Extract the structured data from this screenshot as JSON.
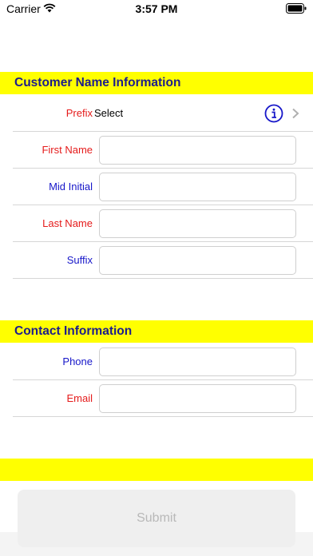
{
  "status_bar": {
    "carrier": "Carrier",
    "time": "3:57 PM"
  },
  "sections": {
    "customer": {
      "title": "Customer Name Information"
    },
    "contact": {
      "title": "Contact Information"
    },
    "empty": {
      "title": ""
    }
  },
  "fields": {
    "prefix": {
      "label": "Prefix",
      "value": "Select"
    },
    "first_name": {
      "label": "First Name",
      "value": ""
    },
    "mid_initial": {
      "label": "Mid Initial",
      "value": ""
    },
    "last_name": {
      "label": "Last Name",
      "value": ""
    },
    "suffix": {
      "label": "Suffix",
      "value": ""
    },
    "phone": {
      "label": "Phone",
      "value": ""
    },
    "email": {
      "label": "Email",
      "value": ""
    }
  },
  "submit": {
    "label": "Submit"
  },
  "colors": {
    "header_bg": "#ffff00",
    "header_text": "#1c1c8c",
    "label_red": "#e51b1b",
    "label_blue": "#1717c9"
  },
  "icons": [
    "wifi-icon",
    "battery-icon",
    "info-icon",
    "chevron-right-icon"
  ]
}
